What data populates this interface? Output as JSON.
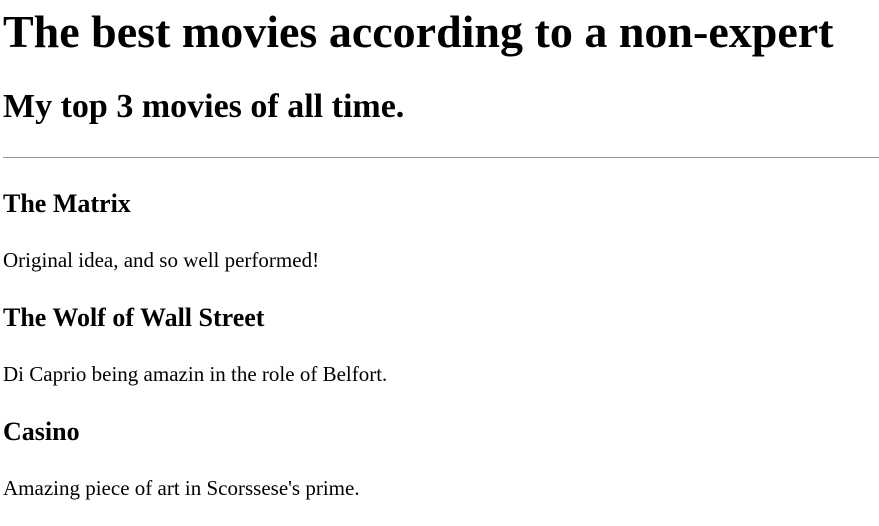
{
  "page": {
    "title": "The best movies according to a non-expert",
    "subtitle": "My top 3 movies of all time."
  },
  "movies": [
    {
      "title": "The Matrix",
      "description": "Original idea, and so well performed!"
    },
    {
      "title": "The Wolf of Wall Street",
      "description": "Di Caprio being amazin in the role of Belfort."
    },
    {
      "title": "Casino",
      "description": "Amazing piece of art in Scorssese's prime."
    }
  ]
}
